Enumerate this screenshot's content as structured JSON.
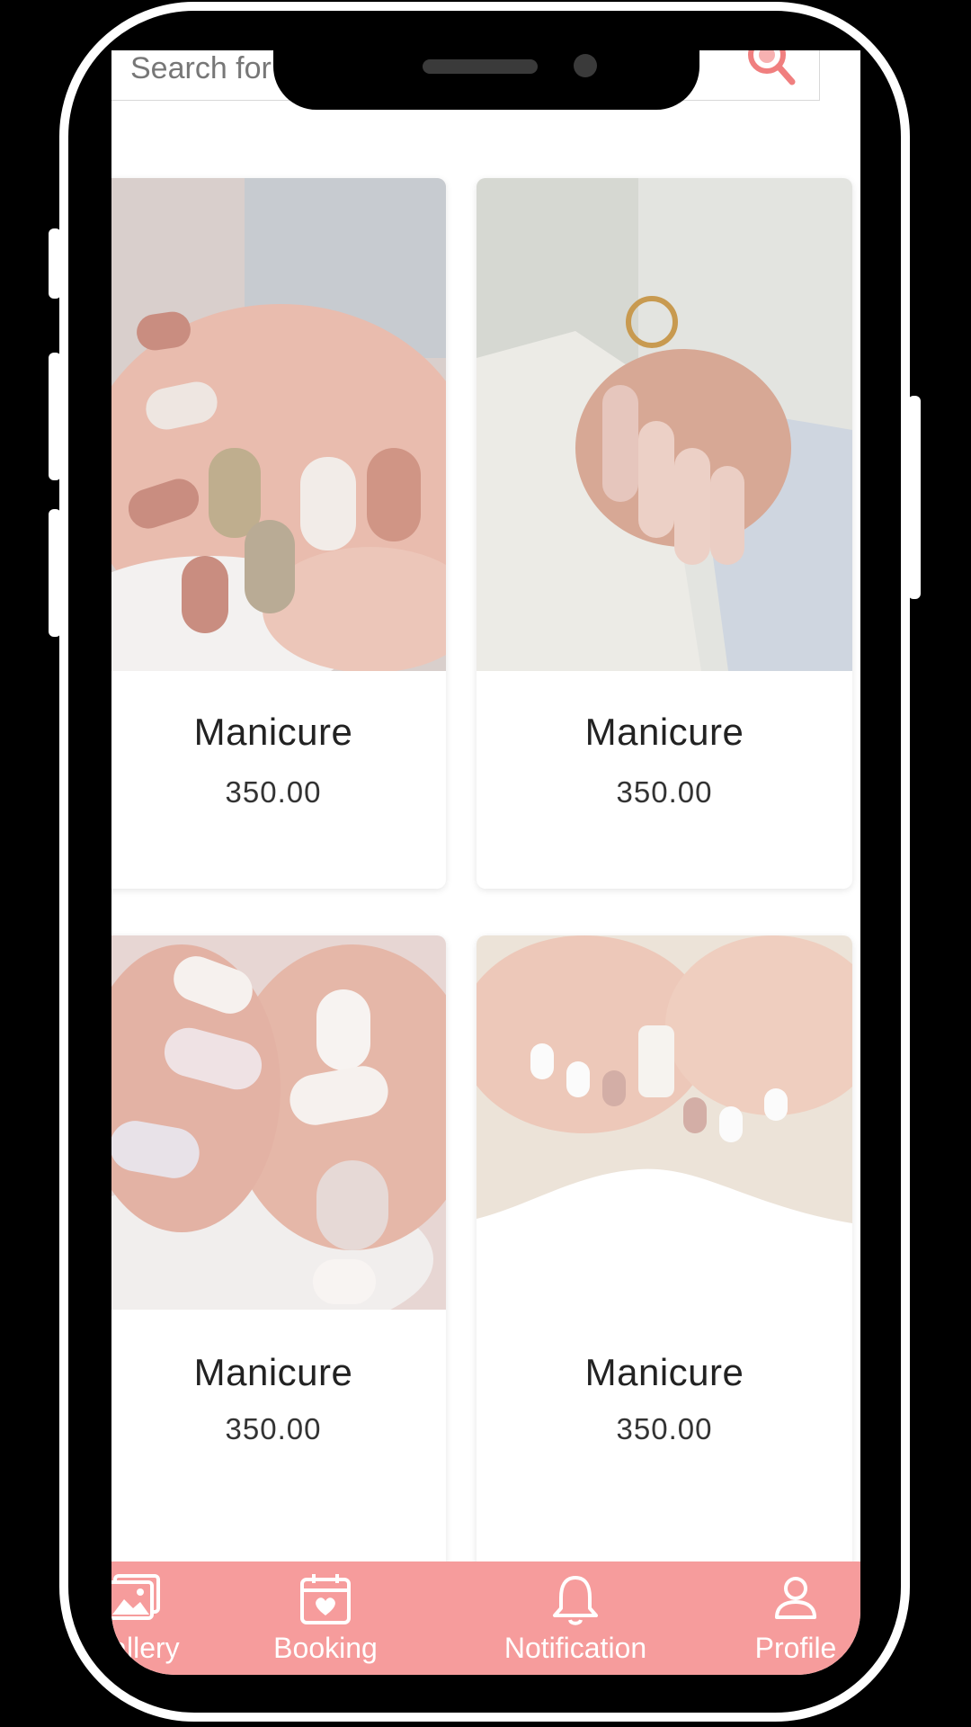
{
  "search": {
    "placeholder": "Search for services"
  },
  "services": [
    {
      "title": "Manicure",
      "price": "350.00"
    },
    {
      "title": "Manicure",
      "price": "350.00"
    },
    {
      "title": "Manicure",
      "price": "350.00"
    },
    {
      "title": "Manicure",
      "price": "350.00"
    }
  ],
  "nav": {
    "items": [
      {
        "label": "Gallery",
        "icon": "gallery-icon"
      },
      {
        "label": "Booking",
        "icon": "calendar-icon"
      },
      {
        "label": "Notification",
        "icon": "bell-icon"
      },
      {
        "label": "Profile",
        "icon": "profile-icon"
      }
    ]
  },
  "colors": {
    "accent": "#f69c9c",
    "nav_text": "#ffffff"
  }
}
